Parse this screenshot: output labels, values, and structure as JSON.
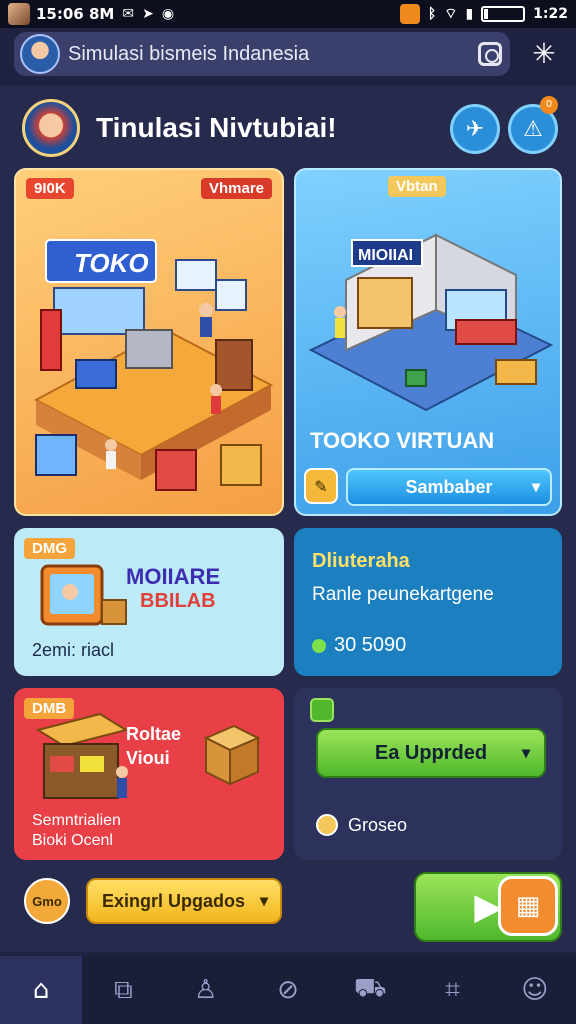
{
  "status_bar": {
    "left_time": "15:06 8M",
    "right_time": "1:22"
  },
  "search": {
    "value": "Simulasi bismeis Indanesia"
  },
  "header": {
    "title": "Tinulasi Nivtubiai!"
  },
  "notification_badge": "0",
  "cards": {
    "store": {
      "tag_left": "9I0K",
      "tag_right": "Vhmare",
      "sign": "TOKO"
    },
    "virtual": {
      "tag": "Vbtan",
      "sign": "MIOIIAI",
      "title": "TOOKO VIRTUAN",
      "button_label": "Sambaber"
    },
    "mobile": {
      "tag": "DMG",
      "line1": "MOIIARE",
      "line2": "BBILAB",
      "caption": "2emi: riacl"
    },
    "stats": {
      "title": "Dliuteraha",
      "subtitle": "Ranle peunekartgene",
      "amount": "30 5090"
    },
    "stock": {
      "tag": "DMB",
      "line1": "Roltae",
      "line2": "Vioui",
      "caption1": "Semntrialien",
      "caption2": "Bioki Ocenl"
    },
    "upgrade": {
      "button_label": "Ea Upprded",
      "amount": "Groseo"
    }
  },
  "footer": {
    "coin_label": "Gmo",
    "select_label": "Exingrl Upgados"
  },
  "colors": {
    "background": "#1f2240",
    "panel": "#262a4d",
    "accent_green": "#4fb82c",
    "accent_blue": "#1e8fe0",
    "accent_yellow": "#f2b51d",
    "accent_red": "#e94048"
  },
  "icons": {
    "nav": [
      "home-icon",
      "window-icon",
      "user-icon",
      "compass-icon",
      "car-icon",
      "crop-icon",
      "face-icon"
    ]
  }
}
